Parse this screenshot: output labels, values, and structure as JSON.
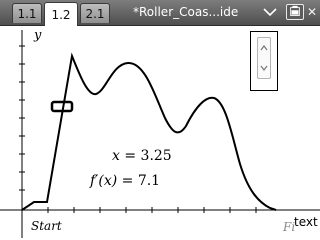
{
  "tabs": [
    {
      "label": "1.1"
    },
    {
      "label": "1.2"
    },
    {
      "label": "2.1"
    }
  ],
  "active_tab": "1.2",
  "document": {
    "title": "*Roller_Coas...ide"
  },
  "graph": {
    "y_axis_label": "y",
    "x_axis_label": "text",
    "start_label": "Start",
    "finish_label": "Fi",
    "readout_x_lhs": "x",
    "readout_x_value": "= 3.25",
    "readout_deriv_lhs": "f′(x)",
    "readout_deriv_value": "= 7.1"
  },
  "icons": {
    "dropdown": "chevron-down-icon",
    "battery": "battery-icon",
    "close": "close-icon",
    "slider_up": "chevron-up-icon",
    "slider_down": "chevron-down-icon"
  },
  "colors": {
    "tabbar": "#5e5e5e",
    "curve": "#000000",
    "tangent_marker": "#000000"
  }
}
